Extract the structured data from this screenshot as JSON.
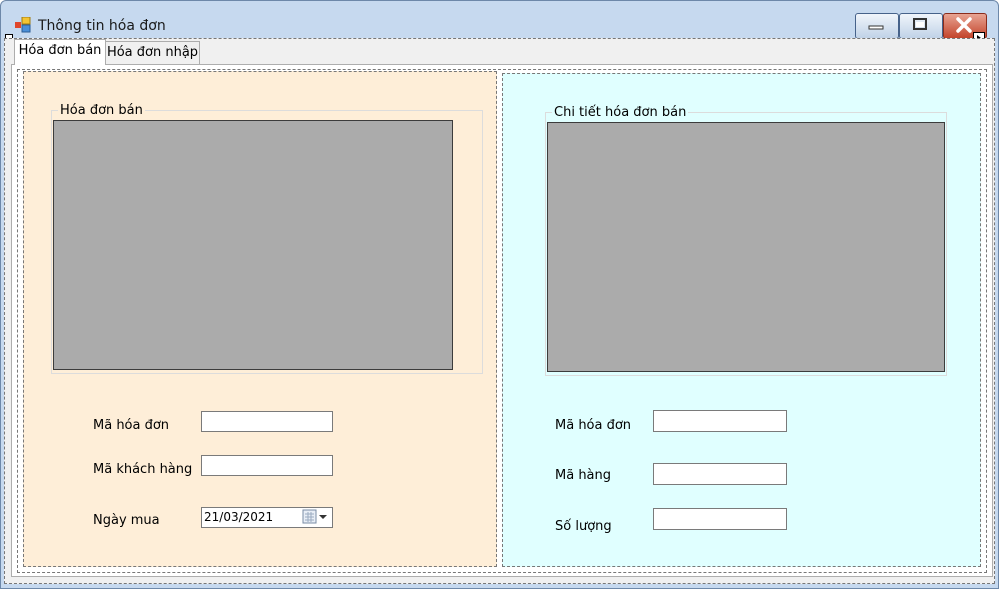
{
  "window": {
    "title": "Thông tin hóa đơn"
  },
  "tabs": [
    {
      "label": "Hóa đơn bán"
    },
    {
      "label": "Hóa đơn nhập"
    }
  ],
  "left_panel": {
    "group_title": "Hóa đơn bán",
    "fields": [
      {
        "label": "Mã hóa đơn",
        "value": ""
      },
      {
        "label": "Mã khách hàng",
        "value": ""
      },
      {
        "label": "Ngày mua",
        "value": "21/03/2021"
      }
    ]
  },
  "right_panel": {
    "group_title": "Chi tiết hóa đơn bán",
    "fields": [
      {
        "label": "Mã hóa đơn",
        "value": ""
      },
      {
        "label": "Mã hàng",
        "value": ""
      },
      {
        "label": "Số lượng",
        "value": ""
      }
    ]
  },
  "colors": {
    "left_bg": "#feeed8",
    "right_bg": "#e0ffff",
    "grid_bg": "#ababab"
  }
}
